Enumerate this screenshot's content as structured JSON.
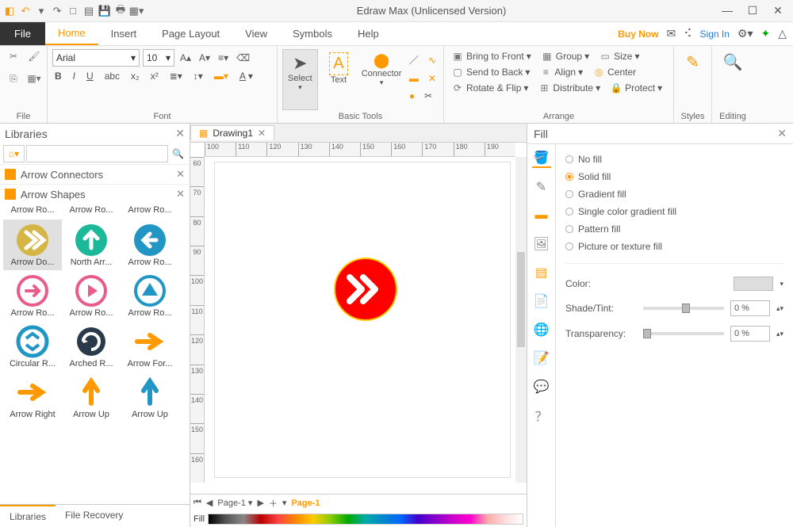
{
  "title": "Edraw Max (Unlicensed Version)",
  "qat_icons": [
    "logo",
    "undo",
    "redo",
    "new",
    "open",
    "save",
    "print",
    "export"
  ],
  "menu": {
    "file": "File",
    "tabs": [
      "Home",
      "Insert",
      "Page Layout",
      "View",
      "Symbols",
      "Help"
    ],
    "active": "Home",
    "buy": "Buy Now",
    "signin": "Sign In"
  },
  "ribbon": {
    "file_label": "File",
    "font_label": "Font",
    "font_name": "Arial",
    "font_size": "10",
    "basic_label": "Basic Tools",
    "select": "Select",
    "text": "Text",
    "connector": "Connector",
    "arrange_label": "Arrange",
    "bring_front": "Bring to Front",
    "send_back": "Send to Back",
    "rotate": "Rotate & Flip",
    "group": "Group",
    "align": "Align",
    "distribute": "Distribute",
    "size": "Size",
    "center": "Center",
    "protect": "Protect",
    "styles": "Styles",
    "editing": "Editing"
  },
  "left": {
    "title": "Libraries",
    "sections": [
      "Arrow Connectors",
      "Arrow Shapes"
    ],
    "labelsrow": [
      "Arrow Ro...",
      "Arrow Ro...",
      "Arrow Ro..."
    ],
    "shapes": [
      {
        "label": "Arrow Do...",
        "sel": true
      },
      {
        "label": "North Arr..."
      },
      {
        "label": "Arrow Ro..."
      },
      {
        "label": "Arrow Ro..."
      },
      {
        "label": "Arrow Ro..."
      },
      {
        "label": "Arrow Ro..."
      },
      {
        "label": "Circular R..."
      },
      {
        "label": "Arched R..."
      },
      {
        "label": "Arrow For..."
      },
      {
        "label": "Arrow Right"
      },
      {
        "label": "Arrow Up"
      },
      {
        "label": "Arrow Up"
      }
    ],
    "foot": {
      "libraries": "Libraries",
      "recovery": "File Recovery"
    }
  },
  "doc": {
    "tab": "Drawing1",
    "hruler": [
      "100",
      "110",
      "120",
      "130",
      "140",
      "150",
      "160",
      "170",
      "180",
      "190"
    ],
    "vruler": [
      "60",
      "70",
      "80",
      "90",
      "100",
      "110",
      "120",
      "130",
      "140",
      "150",
      "160"
    ],
    "page_sel": "Page-1",
    "page_cur": "Page-1",
    "fill_label": "Fill"
  },
  "right": {
    "title": "Fill",
    "options": [
      "No fill",
      "Solid fill",
      "Gradient fill",
      "Single color gradient fill",
      "Pattern fill",
      "Picture or texture fill"
    ],
    "selected": 1,
    "color": "Color:",
    "shade": "Shade/Tint:",
    "shade_val": "0 %",
    "trans": "Transparency:",
    "trans_val": "0 %"
  }
}
